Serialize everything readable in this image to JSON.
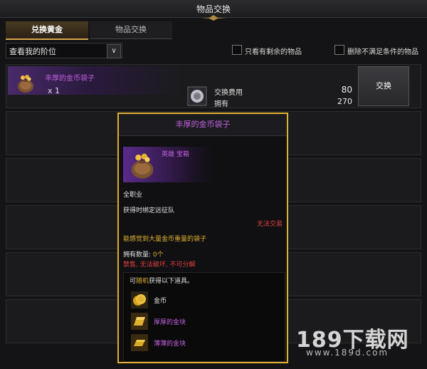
{
  "window": {
    "title": "物品交换"
  },
  "tabs": [
    {
      "label": "兑换黄金",
      "active": true
    },
    {
      "label": "物品交换",
      "active": false
    }
  ],
  "filter": {
    "dropdown_value": "查看我的阶位",
    "checkbox1_label": "只看有剩余的物品",
    "checkbox2_label": "删除不满足条件的物品"
  },
  "row1": {
    "item_name": "丰厚的金币袋子",
    "qty": "x 1",
    "cost_label": "交换费用",
    "cost_value": "80",
    "owned_label": "拥有",
    "owned_value": "270",
    "button_label": "交换"
  },
  "tooltip": {
    "title": "丰厚的金币袋子",
    "type": "英雄 宝箱",
    "class": "全职业",
    "bind": "获得时绑定远征队",
    "tradable": "无法交易",
    "desc": "能感觉到大量金币重量的袋子",
    "owned_label": "拥有数量:",
    "owned_value": "0个",
    "restrictions": "禁售, 无法破坏, 不可分解",
    "random_pre": "可",
    "random_word": "随机",
    "random_post": "获得以下道具。",
    "rewards": [
      "金币",
      "厚厚的金块",
      "薄薄的金块"
    ]
  },
  "watermark": {
    "main": "189下载网",
    "sub": "www.189d.com"
  },
  "colors": {
    "epic_purple": "#c060e0",
    "gold": "#e0b030",
    "red": "#e04040"
  }
}
